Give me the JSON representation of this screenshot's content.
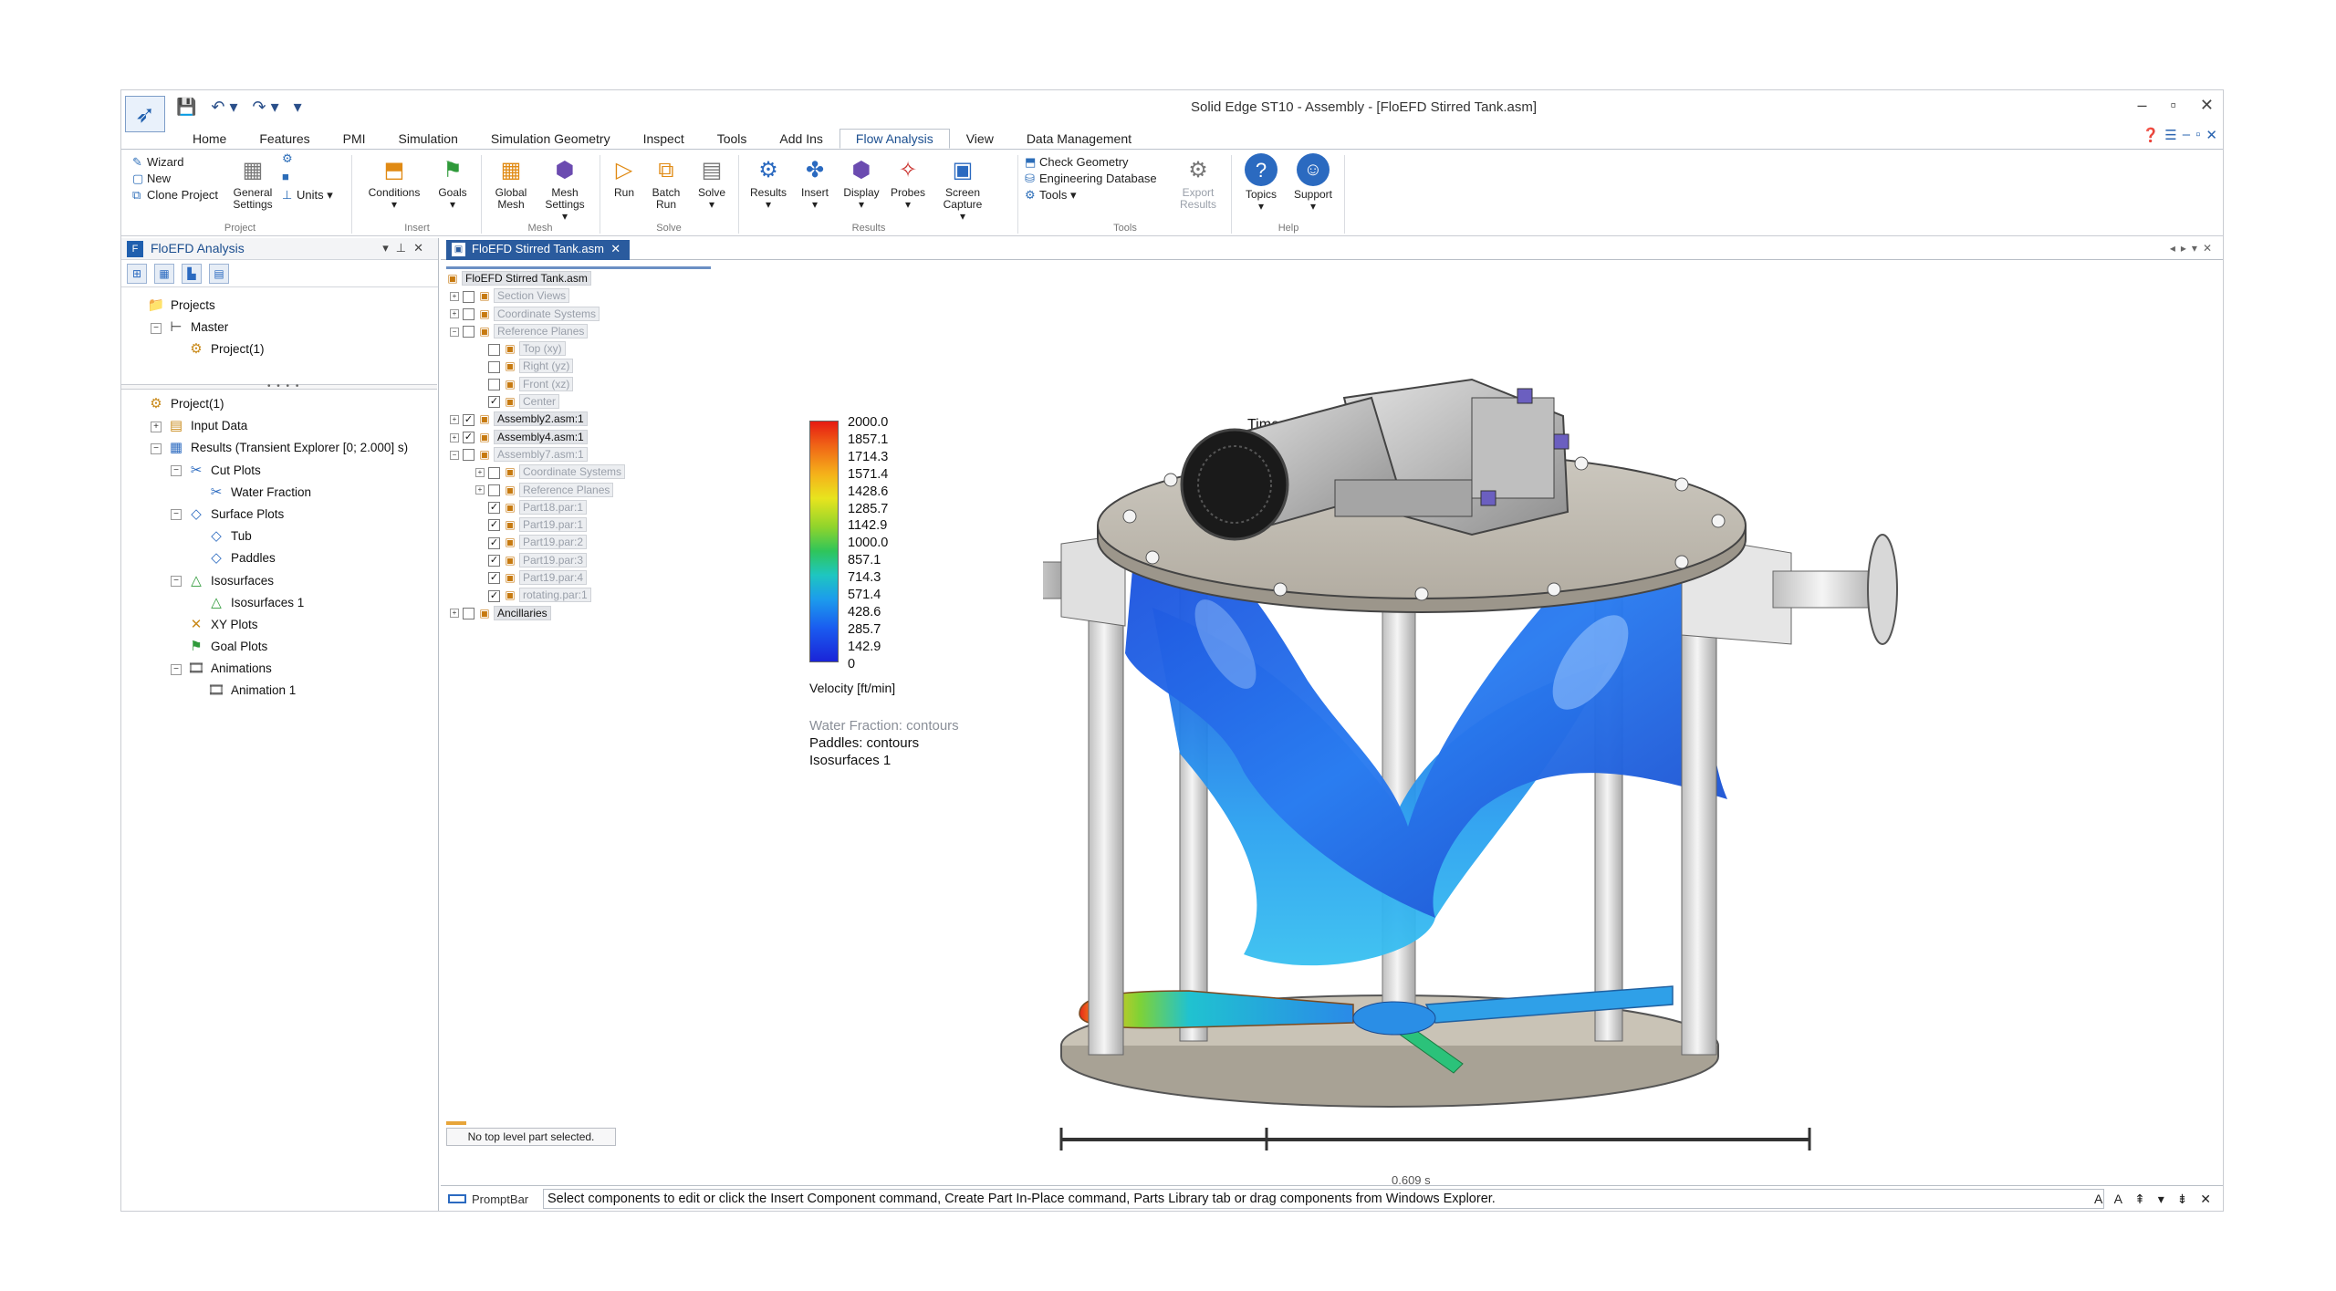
{
  "window": {
    "title": "Solid Edge ST10 - Assembly - [FloEFD Stirred Tank.asm]",
    "controls": [
      "–",
      "▫",
      "✕"
    ]
  },
  "quick_access": [
    "💾",
    "↶ ▾",
    "↷ ▾",
    "▾"
  ],
  "ribbon_tabs": [
    "Home",
    "Features",
    "PMI",
    "Simulation",
    "Simulation Geometry",
    "Inspect",
    "Tools",
    "Add Ins",
    "Flow Analysis",
    "View",
    "Data Management"
  ],
  "active_tab": "Flow Analysis",
  "ribbon": {
    "project": {
      "wizard": "Wizard",
      "new": "New",
      "clone": "Clone Project",
      "general_settings": "General Settings",
      "units": "Units",
      "group": "Project"
    },
    "insert": {
      "conditions": "Conditions",
      "goals": "Goals",
      "group": "Insert"
    },
    "mesh": {
      "global": "Global Mesh",
      "settings": "Mesh Settings",
      "group": "Mesh"
    },
    "solve": {
      "run": "Run",
      "batch": "Batch Run",
      "solve": "Solve",
      "group": "Solve"
    },
    "results": {
      "results": "Results",
      "insert": "Insert",
      "display": "Display",
      "probes": "Probes",
      "capture": "Screen Capture",
      "group": "Results"
    },
    "tools": {
      "check": "Check Geometry",
      "engdb": "Engineering Database",
      "tools": "Tools",
      "export": "Export Results",
      "group": "Tools"
    },
    "help": {
      "topics": "Topics",
      "support": "Support",
      "group": "Help"
    }
  },
  "left_panel": {
    "title": "FloEFD Analysis",
    "projects_tree": [
      {
        "label": "Projects",
        "indent": 0,
        "toggle": "",
        "icon": "folder"
      },
      {
        "label": "Master",
        "indent": 1,
        "toggle": "−",
        "icon": "branch"
      },
      {
        "label": "Project(1)",
        "indent": 2,
        "toggle": "",
        "icon": "project"
      }
    ],
    "analysis_tree": [
      {
        "label": "Project(1)",
        "indent": 0,
        "toggle": "",
        "icon": "project"
      },
      {
        "label": "Input Data",
        "indent": 1,
        "toggle": "+",
        "icon": "input"
      },
      {
        "label": "Results (Transient Explorer [0; 2.000] s)",
        "indent": 1,
        "toggle": "−",
        "icon": "results"
      },
      {
        "label": "Cut Plots",
        "indent": 2,
        "toggle": "−",
        "icon": "cutplot"
      },
      {
        "label": "Water Fraction",
        "indent": 3,
        "toggle": "",
        "icon": "cutplot"
      },
      {
        "label": "Surface Plots",
        "indent": 2,
        "toggle": "−",
        "icon": "surface"
      },
      {
        "label": "Tub",
        "indent": 3,
        "toggle": "",
        "icon": "surface"
      },
      {
        "label": "Paddles",
        "indent": 3,
        "toggle": "",
        "icon": "surface"
      },
      {
        "label": "Isosurfaces",
        "indent": 2,
        "toggle": "−",
        "icon": "iso"
      },
      {
        "label": "Isosurfaces 1",
        "indent": 3,
        "toggle": "",
        "icon": "iso"
      },
      {
        "label": "XY Plots",
        "indent": 2,
        "toggle": "",
        "icon": "xy"
      },
      {
        "label": "Goal Plots",
        "indent": 2,
        "toggle": "",
        "icon": "goal"
      },
      {
        "label": "Animations",
        "indent": 2,
        "toggle": "−",
        "icon": "anim"
      },
      {
        "label": "Animation 1",
        "indent": 3,
        "toggle": "",
        "icon": "anim"
      }
    ]
  },
  "document_tab": "FloEFD Stirred Tank.asm",
  "pathfinder": {
    "root": "FloEFD Stirred Tank.asm",
    "items": [
      {
        "label": "Section Views",
        "indent": 0,
        "toggle": "+",
        "cb": "",
        "dim": true
      },
      {
        "label": "Coordinate Systems",
        "indent": 0,
        "toggle": "+",
        "cb": "",
        "dim": true
      },
      {
        "label": "Reference Planes",
        "indent": 0,
        "toggle": "−",
        "cb": "",
        "dim": true
      },
      {
        "label": "Top (xy)",
        "indent": 1,
        "toggle": "",
        "cb": "",
        "dim": true
      },
      {
        "label": "Right (yz)",
        "indent": 1,
        "toggle": "",
        "cb": "",
        "dim": true
      },
      {
        "label": "Front (xz)",
        "indent": 1,
        "toggle": "",
        "cb": "",
        "dim": true
      },
      {
        "label": "Center",
        "indent": 1,
        "toggle": "",
        "cb": "✓",
        "dim": true
      },
      {
        "label": "Assembly2.asm:1",
        "indent": 0,
        "toggle": "+",
        "cb": "✓",
        "dim": false
      },
      {
        "label": "Assembly4.asm:1",
        "indent": 0,
        "toggle": "+",
        "cb": "✓",
        "dim": false
      },
      {
        "label": "Assembly7.asm:1",
        "indent": 0,
        "toggle": "−",
        "cb": "",
        "dim": true
      },
      {
        "label": "Coordinate Systems",
        "indent": 1,
        "toggle": "+",
        "cb": "",
        "dim": true
      },
      {
        "label": "Reference Planes",
        "indent": 1,
        "toggle": "+",
        "cb": "",
        "dim": true
      },
      {
        "label": "Part18.par:1",
        "indent": 1,
        "toggle": "",
        "cb": "✓",
        "dim": true
      },
      {
        "label": "Part19.par:1",
        "indent": 1,
        "toggle": "",
        "cb": "✓",
        "dim": true
      },
      {
        "label": "Part19.par:2",
        "indent": 1,
        "toggle": "",
        "cb": "✓",
        "dim": true
      },
      {
        "label": "Part19.par:3",
        "indent": 1,
        "toggle": "",
        "cb": "✓",
        "dim": true
      },
      {
        "label": "Part19.par:4",
        "indent": 1,
        "toggle": "",
        "cb": "✓",
        "dim": true
      },
      {
        "label": "rotating.par:1",
        "indent": 1,
        "toggle": "",
        "cb": "✓",
        "dim": true
      },
      {
        "label": "Ancillaries",
        "indent": 0,
        "toggle": "+",
        "cb": "",
        "dim": false
      }
    ],
    "status": "No top level part selected."
  },
  "viewport": {
    "time_label": "Time = 0 s",
    "legend_ticks": [
      "2000.0",
      "1857.1",
      "1714.3",
      "1571.4",
      "1428.6",
      "1285.7",
      "1142.9",
      "1000.0",
      "857.1",
      "714.3",
      "571.4",
      "428.6",
      "285.7",
      "142.9",
      "0"
    ],
    "legend_title": "Velocity [ft/min]",
    "info_lines": [
      "Water Fraction: contours",
      "Paddles: contours",
      "Isosurfaces 1"
    ],
    "scale_label": "0.609 s"
  },
  "promptbar": {
    "label": "PromptBar",
    "text": "Select components to edit or click the Insert Component command, Create Part In-Place command, Parts Library tab or drag components from Windows Explorer.",
    "controls": "A A ⇞ ▾ ⇟ ✕"
  },
  "colors": {
    "accent": "#2a5b9e",
    "legend_top": "#e61b12",
    "legend_bottom": "#1a24d8"
  }
}
